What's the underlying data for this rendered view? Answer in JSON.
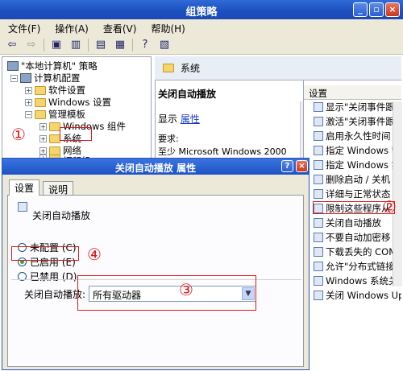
{
  "window": {
    "title": "组策略",
    "minimize": "_",
    "maximize": "▫",
    "close": "×"
  },
  "menu": [
    "文件(F)",
    "操作(A)",
    "查看(V)",
    "帮助(H)"
  ],
  "tree": {
    "root": "\"本地计算机\" 策略",
    "computer": "计算机配置",
    "software": "软件设置",
    "windows_settings": "Windows 设置",
    "admin_templates": "管理模板",
    "windows_components": "Windows 组件",
    "system": "系统",
    "network": "网络",
    "printers": "打印机"
  },
  "right": {
    "header": "系统",
    "policy_title": "关闭自动播放",
    "display_label": "显示",
    "properties_link": "属性",
    "requires_label": "要求:",
    "requires_value": "至少 Microsoft Windows 2000",
    "settings_header": "设置",
    "settings": [
      "显示\"关闭事件跟",
      "激活\"关闭事件跟",
      "启用永久性时间",
      "指定 Windows 安",
      "指定 Windows 实",
      "删除启动 / 关机",
      "详细与正常状态",
      "限制这些程序从",
      "关闭自动播放",
      "不要自动加密移",
      "下载丢失的 COM",
      "允许\"分布式链接",
      "Windows 系统关",
      "关闭 Windows Up"
    ]
  },
  "dialog": {
    "title": "关闭自动播放 属性",
    "help": "?",
    "close": "×",
    "tab_settings": "设置",
    "tab_explain": "说明",
    "policy_name": "关闭自动播放",
    "opt_not_configured": "未配置 (C)",
    "opt_enabled": "已启用 (E)",
    "opt_disabled": "已禁用 (D)",
    "combo_label": "关闭自动播放:",
    "combo_value": "所有驱动器"
  },
  "annotations": {
    "a1": "①",
    "a2": "②",
    "a3": "③",
    "a4": "④",
    "color": "#d81a1a"
  }
}
